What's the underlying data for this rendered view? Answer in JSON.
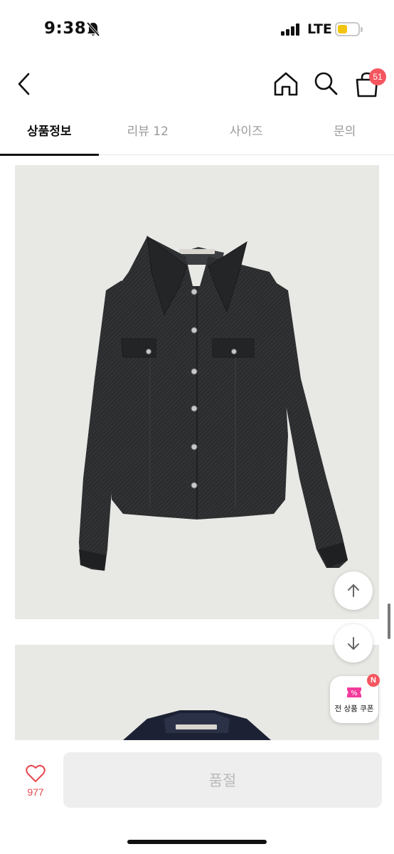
{
  "status_bar": {
    "time": "9:38",
    "network": "LTE",
    "icons": [
      "bell-slash-icon",
      "signal-icon",
      "battery-icon"
    ],
    "battery_color": "#f2c40f"
  },
  "nav": {
    "back_icon": "chevron-left-icon",
    "home_icon": "home-icon",
    "search_icon": "search-icon",
    "cart_icon": "shopping-bag-icon",
    "cart_count": "51"
  },
  "tabs": [
    {
      "label": "상품정보",
      "active": true
    },
    {
      "label": "리뷰 12",
      "active": false
    },
    {
      "label": "사이즈",
      "active": false
    },
    {
      "label": "문의",
      "active": false
    }
  ],
  "content": {
    "images": [
      "black-denim-shirt-front",
      "navy-denim-shirt-front"
    ]
  },
  "floating": {
    "scroll_up_icon": "arrow-up-icon",
    "scroll_down_icon": "arrow-down-icon",
    "coupon_label": "전 상품 쿠폰",
    "coupon_badge": "N",
    "coupon_icon": "coupon-ticket-icon"
  },
  "bottom_bar": {
    "like_icon": "heart-icon",
    "like_count": "977",
    "buy_button_label": "품절"
  },
  "colors": {
    "accent_red": "#f5565f",
    "heart_red": "#e8474f",
    "image_bg": "#e8e8e5"
  }
}
